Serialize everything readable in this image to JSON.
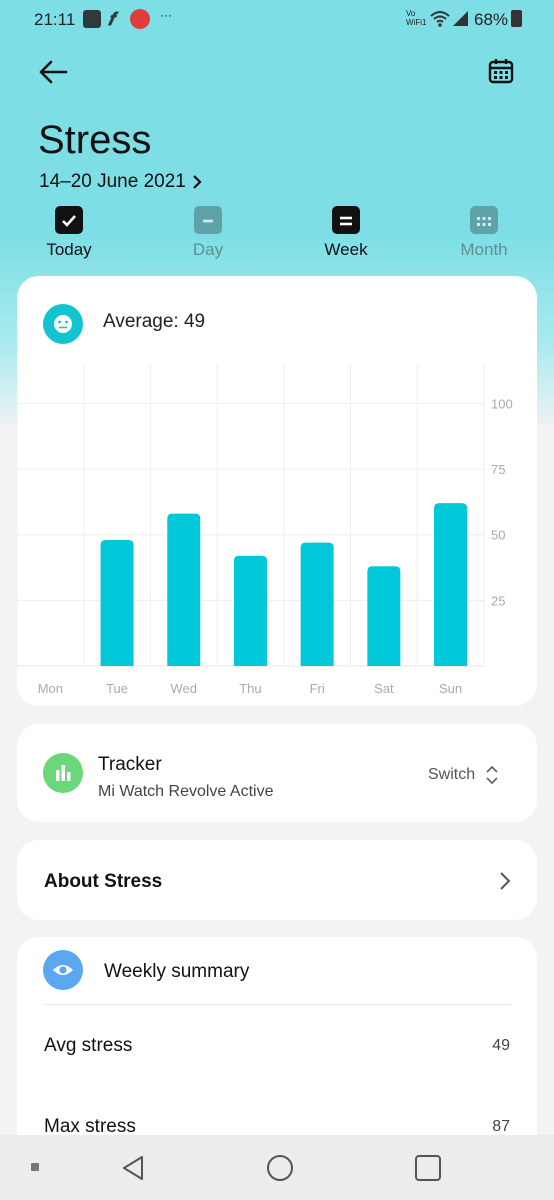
{
  "status_bar": {
    "time": "21:11",
    "more": "···",
    "volte": "Vo\nWiFi1",
    "battery": "68%"
  },
  "header": {
    "title": "Stress",
    "date_range": "14–20 June 2021"
  },
  "tabs": [
    {
      "label": "Today"
    },
    {
      "label": "Day"
    },
    {
      "label": "Week"
    },
    {
      "label": "Month"
    }
  ],
  "average": {
    "label": "Average: 49"
  },
  "chart_data": {
    "type": "bar",
    "categories": [
      "Mon",
      "Tue",
      "Wed",
      "Thu",
      "Fri",
      "Sat",
      "Sun"
    ],
    "values": [
      0,
      48,
      58,
      42,
      47,
      38,
      62
    ],
    "ylim": [
      0,
      115
    ],
    "yticks": [
      25,
      50,
      75,
      100
    ],
    "bar_color": "#00c8d8",
    "grid": true
  },
  "tracker": {
    "title": "Tracker",
    "device": "Mi Watch Revolve Active",
    "switch_label": "Switch"
  },
  "about": {
    "label": "About Stress"
  },
  "summary": {
    "title": "Weekly summary",
    "rows": [
      {
        "label": "Avg stress",
        "value": "49"
      },
      {
        "label": "Max stress",
        "value": "87"
      }
    ]
  },
  "colors": {
    "accent": "#00c8d8",
    "header_bg": "#7ddfe5",
    "tracker_icon": "#6cd77a",
    "summary_icon": "#5aa7f2"
  }
}
